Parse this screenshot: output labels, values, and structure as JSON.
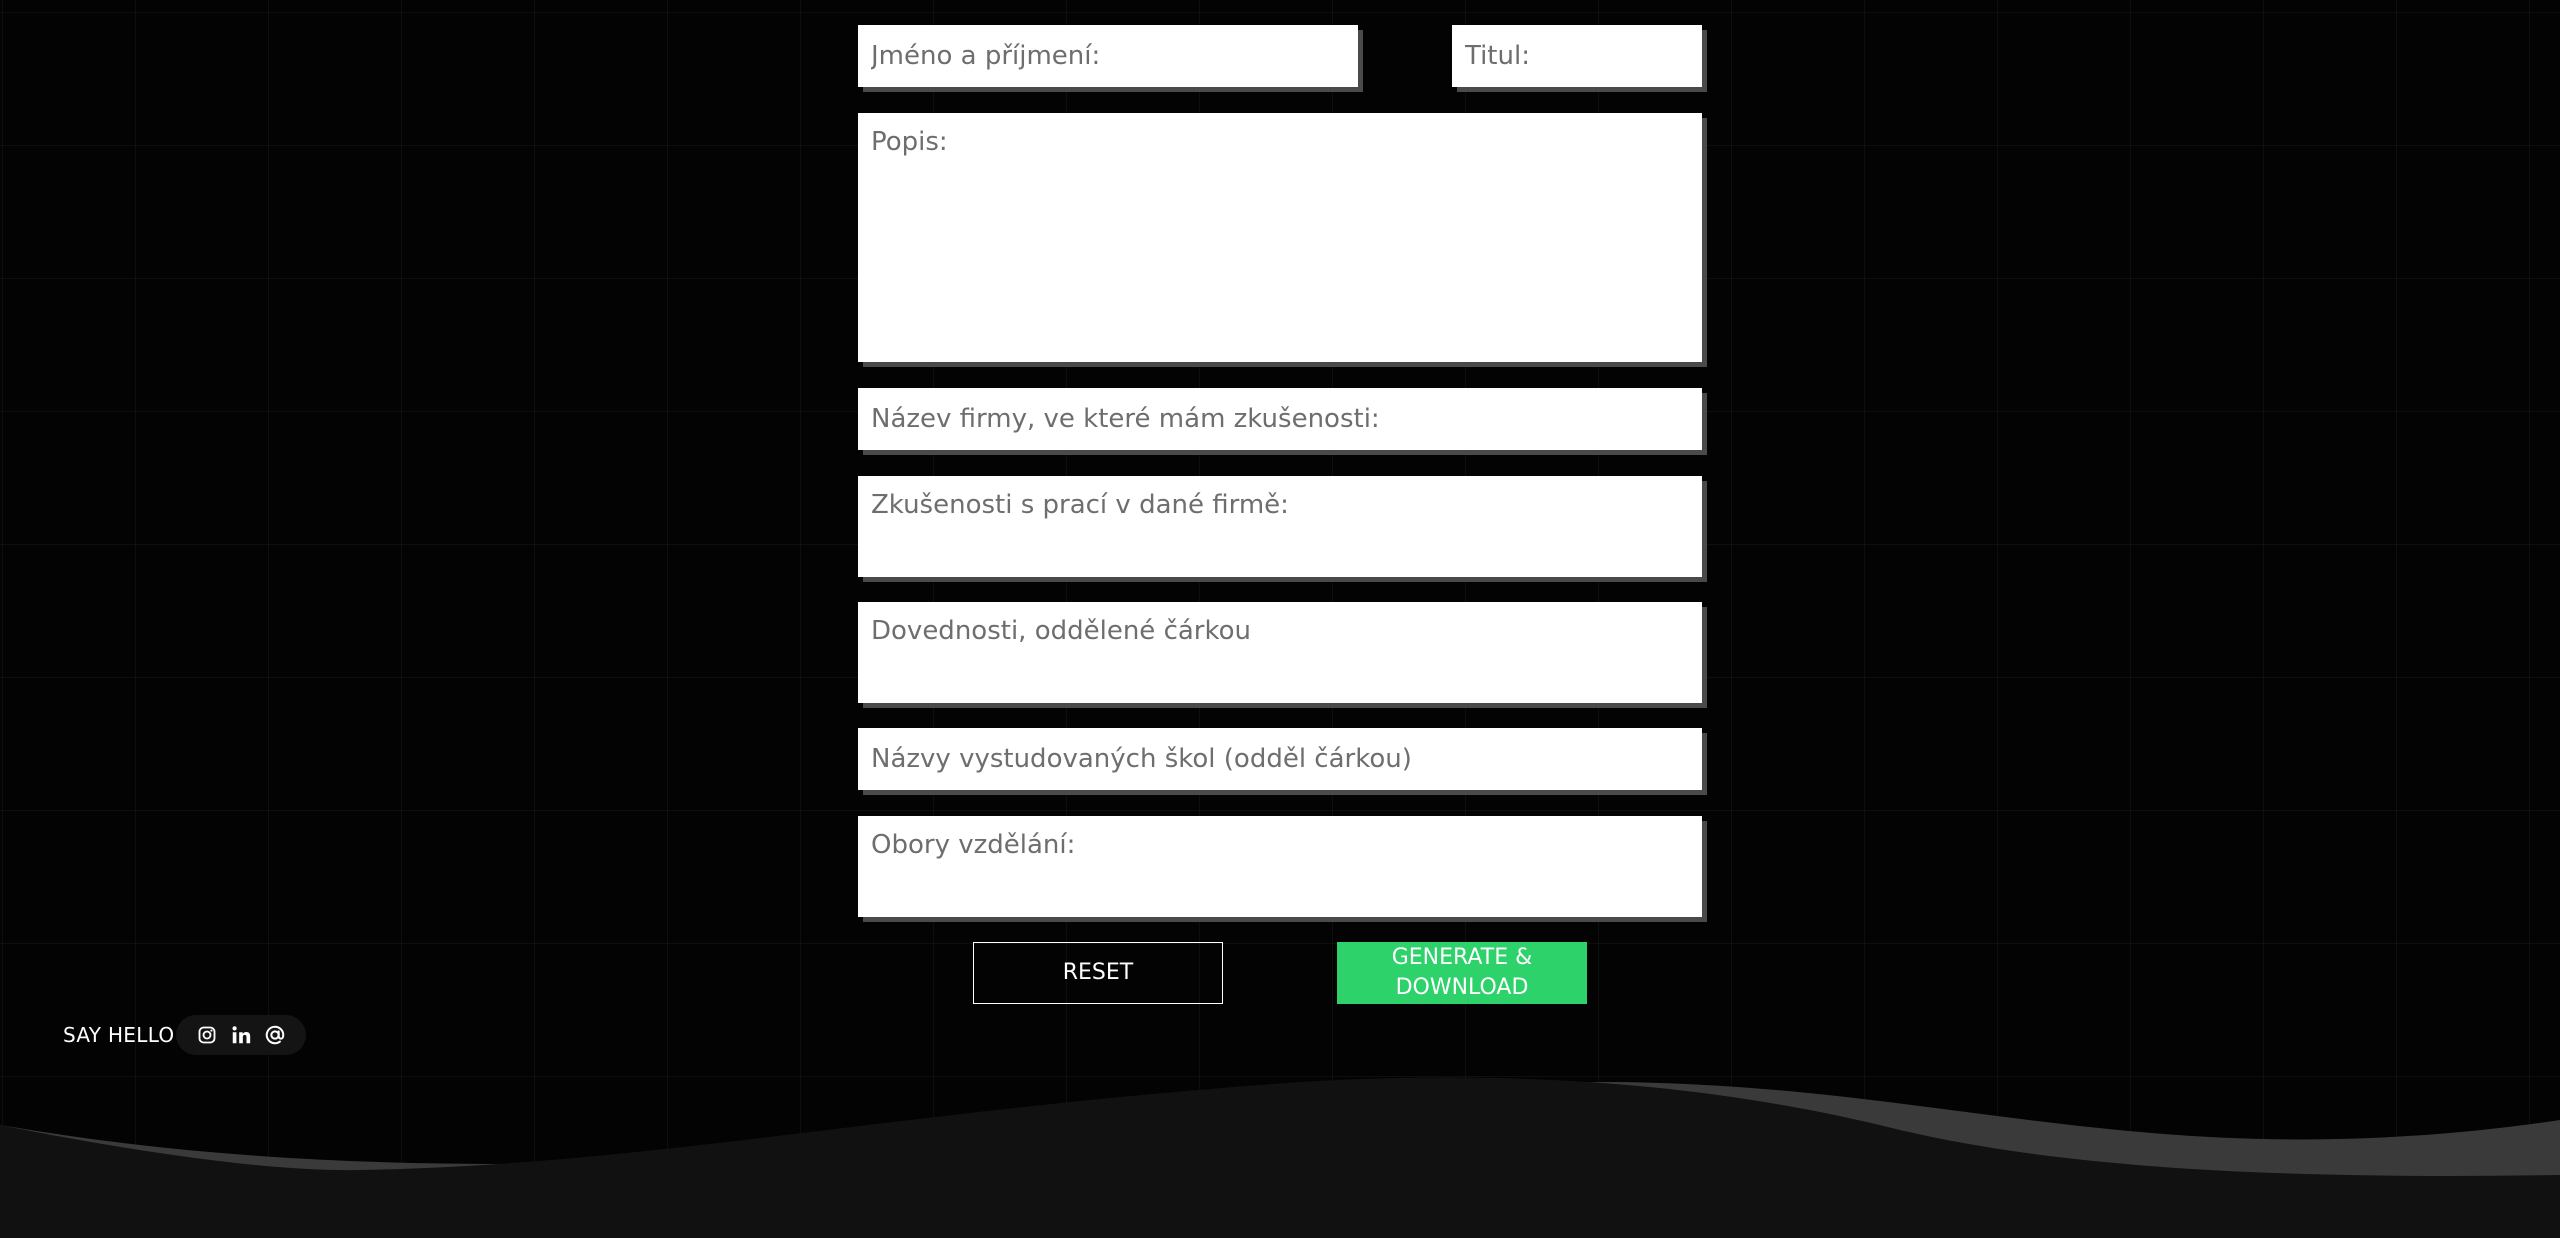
{
  "form": {
    "name_placeholder": "Jméno a příjmení:",
    "title_placeholder": "Titul:",
    "description_placeholder": "Popis:",
    "company_placeholder": "Název firmy, ve které mám zkušenosti:",
    "experience_placeholder": "Zkušenosti s prací v dané firmě:",
    "skills_placeholder": "Dovednosti, oddělené čárkou",
    "schools_placeholder": "Názvy vystudovaných škol (odděl čárkou)",
    "fields_of_study_placeholder": "Obory vzdělání:"
  },
  "buttons": {
    "reset_label": "RESET",
    "generate_label": "GENERATE & DOWNLOAD"
  },
  "footer": {
    "say_hello": "SAY HELLO",
    "social_icons": [
      "instagram-icon",
      "linkedin-icon",
      "at-sign-icon"
    ]
  },
  "colors": {
    "background": "#030303",
    "accent_green": "#2ed26b",
    "field_shadow": "#4a4a4a",
    "wave_dark": "#111111",
    "wave_light": "#3a3a3a"
  }
}
